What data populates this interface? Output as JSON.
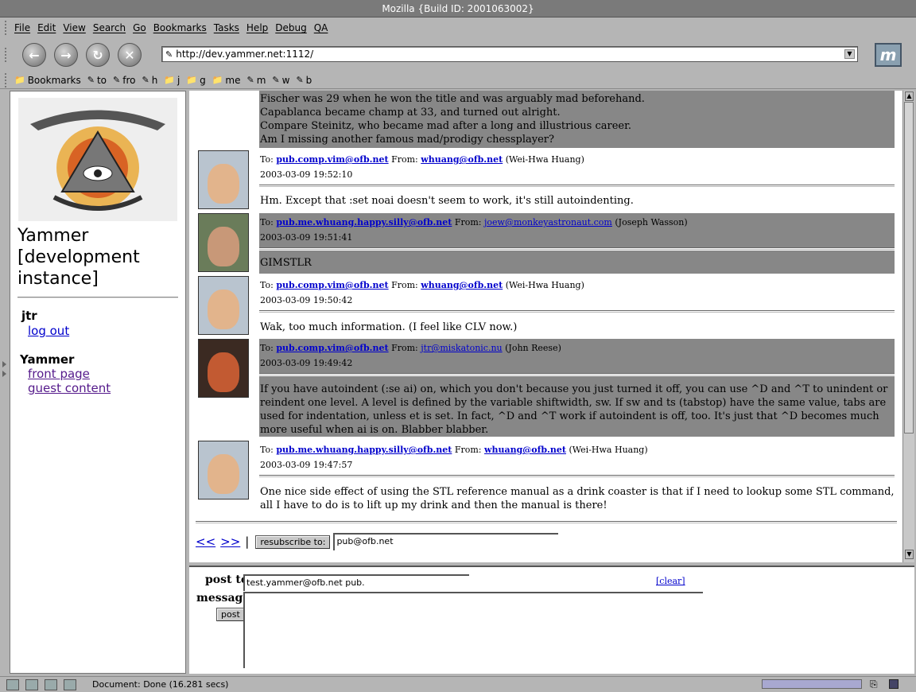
{
  "window": {
    "title": "Mozilla {Build ID: 2001063002}"
  },
  "menu": [
    "File",
    "Edit",
    "View",
    "Search",
    "Go",
    "Bookmarks",
    "Tasks",
    "Help",
    "Debug",
    "QA"
  ],
  "nav": {
    "url": "http://dev.yammer.net:1112/"
  },
  "bookmarks": [
    {
      "icon": "folder-icon",
      "label": "Bookmarks"
    },
    {
      "icon": "bookmark-icon",
      "label": "to"
    },
    {
      "icon": "bookmark-icon",
      "label": "fro"
    },
    {
      "icon": "bookmark-icon",
      "label": "h"
    },
    {
      "icon": "folder-icon",
      "label": "j"
    },
    {
      "icon": "folder-icon",
      "label": "g"
    },
    {
      "icon": "folder-icon",
      "label": "me"
    },
    {
      "icon": "bookmark-icon",
      "label": "m"
    },
    {
      "icon": "bookmark-icon",
      "label": "w"
    },
    {
      "icon": "bookmark-icon",
      "label": "b"
    }
  ],
  "sidebar": {
    "title": "Yammer [development instance]",
    "user": "jtr",
    "logout": "log out",
    "section": "Yammer",
    "links": [
      "front page",
      "guest content"
    ]
  },
  "messages": [
    {
      "body": "Fischer was 29 when he won the title and was arguably mad beforehand.\nCapablanca became champ at 33, and turned out alright.\nCompare Steinitz, who became mad after a long and illustrious career.\nAm I missing another famous mad/prodigy chessplayer?"
    },
    {
      "to_label": "To:",
      "to": "pub.comp.vim@ofb.net",
      "from_label": "From:",
      "from": "whuang@ofb.net",
      "from_name": "(Wei-Hwa Huang)",
      "date": "2003-03-09 19:52:10",
      "body": "Hm. Except that :set noai doesn't seem to work, it's still autoindenting."
    },
    {
      "to_label": "To:",
      "to": "pub.me.whuang.happy.silly@ofb.net",
      "from_label": "From:",
      "from": "joew@monkeyastronaut.com",
      "from_name": "(Joseph Wasson)",
      "date": "2003-03-09 19:51:41",
      "body": "GIMSTLR"
    },
    {
      "to_label": "To:",
      "to": "pub.comp.vim@ofb.net",
      "from_label": "From:",
      "from": "whuang@ofb.net",
      "from_name": "(Wei-Hwa Huang)",
      "date": "2003-03-09 19:50:42",
      "body": "Wak, too much information. (I feel like CLV now.)"
    },
    {
      "to_label": "To:",
      "to": "pub.comp.vim@ofb.net",
      "from_label": "From:",
      "from": "jtr@miskatonic.nu",
      "from_name": "(John Reese)",
      "date": "2003-03-09 19:49:42",
      "body": "If you have autoindent (:se ai) on, which you don't because you just turned it off, you can use ^D and ^T to unindent or reindent one level. A level is defined by the variable shiftwidth, sw. If sw and ts (tabstop) have the same value, tabs are used for indentation, unless et is set. In fact, ^D and ^T work if autoindent is off, too. It's just that ^D becomes much more useful when ai is on. Blabber blabber."
    },
    {
      "to_label": "To:",
      "to": "pub.me.whuang.happy.silly@ofb.net",
      "from_label": "From:",
      "from": "whuang@ofb.net",
      "from_name": "(Wei-Hwa Huang)",
      "date": "2003-03-09 19:47:57",
      "body": "One nice side effect of using the STL reference manual as a drink coaster is that if I need to lookup some STL command, all I have to do is to lift up my drink and then the manual is there!"
    }
  ],
  "pager": {
    "prev": "<<",
    "next": ">>",
    "sep": "|",
    "resubscribe_label": "resubscribe to:",
    "resubscribe_value": "pub@ofb.net"
  },
  "post": {
    "post_to_label": "post to",
    "post_to_value": "test.yammer@ofb.net pub.",
    "clear_label": "[clear]",
    "message_label": "message",
    "post_button": "post"
  },
  "status": {
    "text": "Document: Done (16.281 secs)"
  }
}
